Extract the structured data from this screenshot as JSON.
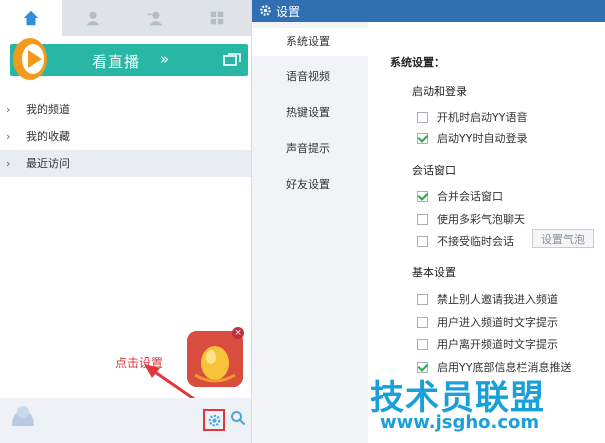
{
  "left_panel": {
    "tabs": [
      "home-icon",
      "contact-icon",
      "group-icon",
      "apps-icon"
    ],
    "banner": {
      "label": "看直播",
      "arrows": "»"
    },
    "nav_items": [
      {
        "label": "我的频道"
      },
      {
        "label": "我的收藏"
      },
      {
        "label": "最近访问"
      }
    ],
    "annotation": "点击设置"
  },
  "settings": {
    "title": "设置",
    "nav": [
      "系统设置",
      "语音视频",
      "热键设置",
      "声音提示",
      "好友设置"
    ],
    "section_title": "系统设置：",
    "groups": {
      "startup": {
        "title": "启动和登录",
        "options": [
          {
            "label": "开机时启动YY语音",
            "checked": false
          },
          {
            "label": "启动YY时自动登录",
            "checked": true
          }
        ]
      },
      "session": {
        "title": "会话窗口",
        "options": [
          {
            "label": "合并会话窗口",
            "checked": true
          },
          {
            "label": "使用多彩气泡聊天",
            "checked": false
          },
          {
            "label": "不接受临时会话",
            "checked": false
          }
        ],
        "bubble_button": "设置气泡"
      },
      "basic": {
        "title": "基本设置",
        "options": [
          {
            "label": "禁止别人邀请我进入频道",
            "checked": false
          },
          {
            "label": "用户进入频道时文字提示",
            "checked": false
          },
          {
            "label": "用户离开频道时文字提示",
            "checked": false
          },
          {
            "label": "启用YY底部信息栏消息推送",
            "checked": true
          }
        ]
      }
    }
  },
  "watermark": {
    "line1": "技术员联盟",
    "line2": "www.jsgho.com"
  },
  "colors": {
    "accent_teal": "#27b7a4",
    "title_blue": "#2f6fb2",
    "annotation_red": "#e0373b",
    "check_green": "#2aa548"
  }
}
